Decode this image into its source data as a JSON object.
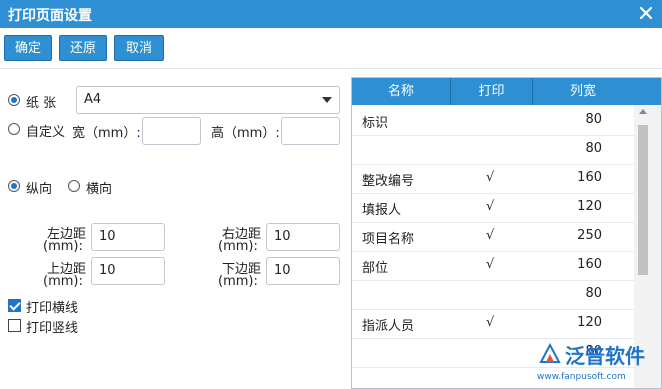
{
  "window": {
    "title": "打印页面设置"
  },
  "toolbar": {
    "confirm": "确定",
    "restore": "还原",
    "cancel": "取消"
  },
  "paper": {
    "paper_label": "纸 张",
    "paper_value": "A4",
    "custom_label": "自定义",
    "width_label": "宽（mm）:",
    "width_value": "",
    "height_label": "高（mm）:",
    "height_value": ""
  },
  "orientation": {
    "portrait": "纵向",
    "landscape": "横向"
  },
  "margins": {
    "left_label_1": "左边距",
    "left_label_2": "(mm):",
    "left_value": "10",
    "right_label_1": "右边距",
    "right_label_2": "(mm):",
    "right_value": "10",
    "top_label_1": "上边距",
    "top_label_2": "(mm):",
    "top_value": "10",
    "bottom_label_1": "下边距",
    "bottom_label_2": "(mm):",
    "bottom_value": "10"
  },
  "options": {
    "print_hlines": "打印横线",
    "print_vlines": "打印竖线",
    "print_hlines_checked": true,
    "print_vlines_checked": false
  },
  "table": {
    "headers": [
      "名称",
      "打印",
      "列宽"
    ],
    "rows": [
      {
        "name": "标识",
        "print": "",
        "width": "80"
      },
      {
        "name": "",
        "print": "",
        "width": "80"
      },
      {
        "name": "整改编号",
        "print": "√",
        "width": "160"
      },
      {
        "name": "填报人",
        "print": "√",
        "width": "120"
      },
      {
        "name": "项目名称",
        "print": "√",
        "width": "250"
      },
      {
        "name": "部位",
        "print": "√",
        "width": "160"
      },
      {
        "name": "",
        "print": "",
        "width": "80"
      },
      {
        "name": "指派人员",
        "print": "√",
        "width": "120"
      },
      {
        "name": "",
        "print": "",
        "width": "80"
      }
    ]
  },
  "watermark": {
    "brand": "泛普软件",
    "url": "www.fanpusoft.com"
  },
  "colors": {
    "accent": "#2e8fd3",
    "accent_dark": "#1d6ea9"
  }
}
